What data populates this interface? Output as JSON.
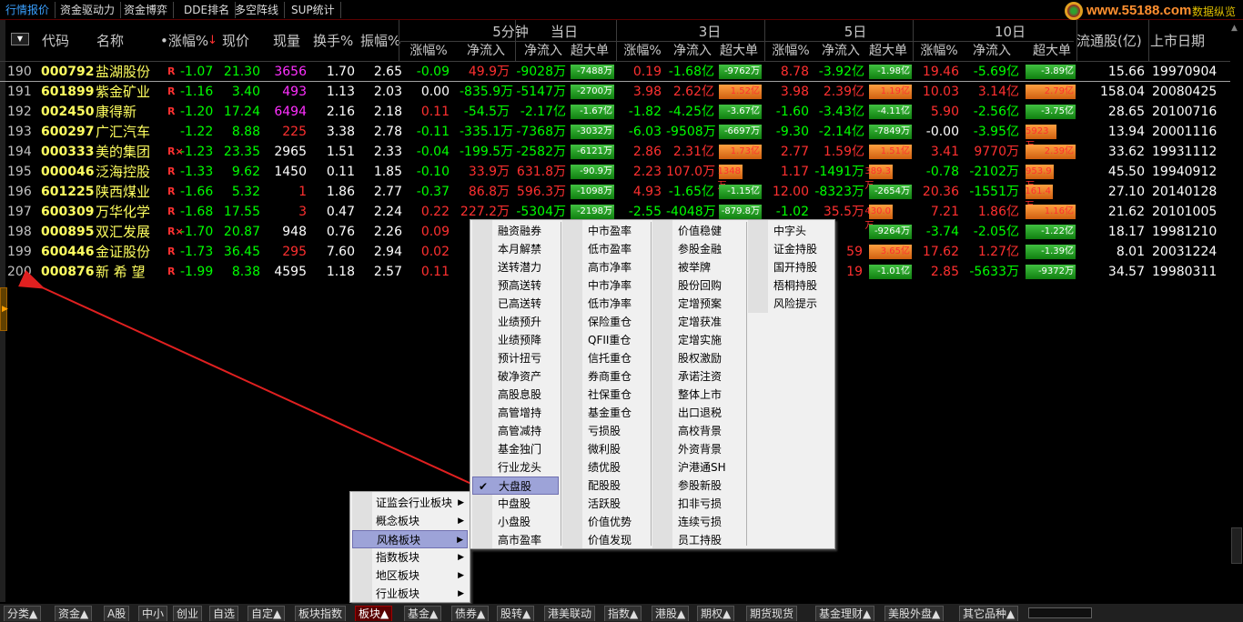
{
  "top_tabs": [
    "行情报价",
    "资金驱动力",
    "资金博弈",
    "DDE排名",
    "多空阵线",
    "SUP统计"
  ],
  "brand": {
    "logo_text": "www.55188.com",
    "data_view": "数据纵览"
  },
  "header": {
    "groups": [
      "5分钟",
      "当日",
      "3日",
      "5日",
      "10日"
    ],
    "cols": [
      "代码",
      "名称",
      "•涨幅%",
      "现价",
      "现量",
      "换手%",
      "振幅%",
      "涨幅%",
      "净流入",
      "净流入",
      "超大单",
      "涨幅%",
      "净流入",
      "超大单",
      "涨幅%",
      "净流入",
      "超大单",
      "涨幅%",
      "净流入",
      "超大单",
      "流通股(亿)",
      "上市日期"
    ],
    "sort_glyph": "↓"
  },
  "rows": [
    [
      "190",
      "000792",
      "盐湖股份",
      "R",
      "-1.07",
      "21.30",
      "3656",
      "1.70",
      "2.65",
      "-0.09",
      "49.9万",
      "-9028万",
      "-7488万",
      "0.19",
      "-1.68亿",
      "-9762万",
      "8.78",
      "-3.92亿",
      "-1.98亿",
      "19.46",
      "-5.69亿",
      "-3.89亿",
      "15.66",
      "19970904"
    ],
    [
      "191",
      "601899",
      "紫金矿业",
      "R",
      "-1.16",
      "3.40",
      "493",
      "1.13",
      "2.03",
      "0.00",
      "-835.9万",
      "-5147万",
      "-2700万",
      "3.98",
      "2.62亿",
      "1.52亿",
      "3.98",
      "2.39亿",
      "1.19亿",
      "10.03",
      "3.14亿",
      "2.79亿",
      "158.04",
      "20080425"
    ],
    [
      "192",
      "002450",
      "康得新",
      "R",
      "-1.20",
      "17.24",
      "6494",
      "2.16",
      "2.18",
      "0.11",
      "-54.5万",
      "-2.17亿",
      "-1.67亿",
      "-1.82",
      "-4.25亿",
      "-3.67亿",
      "-1.60",
      "-3.43亿",
      "-4.11亿",
      "5.90",
      "-2.56亿",
      "-3.75亿",
      "28.65",
      "20100716"
    ],
    [
      "193",
      "600297",
      "广汇汽车",
      "",
      "-1.22",
      "8.88",
      "225",
      "3.38",
      "2.78",
      "-0.11",
      "-335.1万",
      "-7368万",
      "-3032万",
      "-6.03",
      "-9508万",
      "-6697万",
      "-9.30",
      "-2.14亿",
      "-7849万",
      "-0.00",
      "-3.95亿",
      "5923万",
      "13.94",
      "20001116"
    ],
    [
      "194",
      "000333",
      "美的集团",
      "R×",
      "-1.23",
      "23.35",
      "2965",
      "1.51",
      "2.33",
      "-0.04",
      "-199.5万",
      "-2582万",
      "-6121万",
      "2.86",
      "2.31亿",
      "1.73亿",
      "2.77",
      "1.59亿",
      "1.51亿",
      "3.41",
      "9770万",
      "2.39亿",
      "33.62",
      "19931112"
    ],
    [
      "195",
      "000046",
      "泛海控股",
      "R",
      "-1.33",
      "9.62",
      "1450",
      "0.11",
      "1.85",
      "-0.10",
      "33.9万",
      "631.8万",
      "-90.9万",
      "2.23",
      "107.0万",
      "1348万",
      "1.17",
      "-1491万",
      "389.3万",
      "-0.78",
      "-2102万",
      "953.9万",
      "45.50",
      "19940912"
    ],
    [
      "196",
      "601225",
      "陕西煤业",
      "R",
      "-1.66",
      "5.32",
      "1",
      "1.86",
      "2.77",
      "-0.37",
      "86.8万",
      "596.3万",
      "-1098万",
      "4.93",
      "-1.65亿",
      "-1.15亿",
      "12.00",
      "-8323万",
      "-2654万",
      "20.36",
      "-1551万",
      "161.4万",
      "27.10",
      "20140128"
    ],
    [
      "197",
      "600309",
      "万华化学",
      "R",
      "-1.68",
      "17.55",
      "3",
      "0.47",
      "2.24",
      "0.22",
      "227.2万",
      "-5304万",
      "-2198万",
      "-2.55",
      "-4048万",
      "-879.8万",
      "-1.02",
      "35.5万",
      "430.0万",
      "7.21",
      "1.86亿",
      "1.16亿",
      "21.62",
      "20101005"
    ],
    [
      "198",
      "000895",
      "双汇发展",
      "R×",
      "-1.70",
      "20.87",
      "948",
      "0.76",
      "2.26",
      "0.09",
      "",
      "",
      "",
      "",
      "",
      "",
      "",
      "",
      "-9264万",
      "-3.74",
      "-2.05亿",
      "-1.22亿",
      "18.17",
      "19981210"
    ],
    [
      "199",
      "600446",
      "金证股份",
      "R",
      "-1.73",
      "36.45",
      "295",
      "7.60",
      "2.94",
      "0.02",
      "",
      "",
      "",
      "",
      "",
      "",
      "",
      "",
      "3.65亿",
      "17.62",
      "1.27亿",
      "-1.39亿",
      "8.01",
      "20031224"
    ],
    [
      "200",
      "000876",
      "新 希 望",
      "R",
      "-1.99",
      "8.38",
      "4595",
      "1.18",
      "2.57",
      "0.11",
      "",
      "",
      "",
      "",
      "",
      "",
      "",
      "",
      "-1.01亿",
      "2.85",
      "-5633万",
      "-9372万",
      "34.57",
      "19980311"
    ]
  ],
  "row_partial_tail": {
    "198": "",
    "199": "59",
    "200": "19"
  },
  "context_menu": {
    "level1": [
      "证监会行业板块",
      "概念板块",
      "风格板块",
      "指数板块",
      "地区板块",
      "行业板块"
    ],
    "level1_active": 2,
    "level2_col1": [
      "融资融券",
      "本月解禁",
      "送转潜力",
      "预高送转",
      "已高送转",
      "业绩预升",
      "业绩预降",
      "预计扭亏",
      "破净资产",
      "高股息股",
      "高管增持",
      "高管减持",
      "基金独门",
      "行业龙头",
      "大盘股",
      "中盘股",
      "小盘股",
      "高市盈率"
    ],
    "level2_col1_checked": 14,
    "level2_col2": [
      "中市盈率",
      "低市盈率",
      "高市净率",
      "中市净率",
      "低市净率",
      "保险重仓",
      "QFII重仓",
      "信托重仓",
      "券商重仓",
      "社保重仓",
      "基金重仓",
      "亏损股",
      "微利股",
      "绩优股",
      "配股股",
      "活跃股",
      "价值优势",
      "价值发现"
    ],
    "level2_col3": [
      "价值稳健",
      "参股金融",
      "被举牌",
      "股份回购",
      "定增预案",
      "定增获准",
      "定增实施",
      "股权激励",
      "承诺注资",
      "整体上市",
      "出口退税",
      "高校背景",
      "外资背景",
      "沪港通SH",
      "参股新股",
      "扣非亏损",
      "连续亏损",
      "员工持股"
    ],
    "level2_col4": [
      "中字头",
      "证金持股",
      "国开持股",
      "梧桐持股",
      "风险提示"
    ],
    "check_glyph": "✔"
  },
  "bottom_tabs": [
    "分类▲",
    "资金▲",
    "A股",
    "中小",
    "创业",
    "自选",
    "自定▲",
    "板块指数",
    "板块▲",
    "基金▲",
    "债券▲",
    "股转▲",
    "港美联动",
    "指数▲",
    "港股▲",
    "期权▲",
    "期货现货",
    "基金理财▲",
    "美股外盘▲",
    "其它品种▲"
  ],
  "bottom_active": 8,
  "colors": {
    "red": "#ff3030",
    "green": "#00ff00",
    "yellow": "#ffff60",
    "annotation": "#e02020"
  }
}
